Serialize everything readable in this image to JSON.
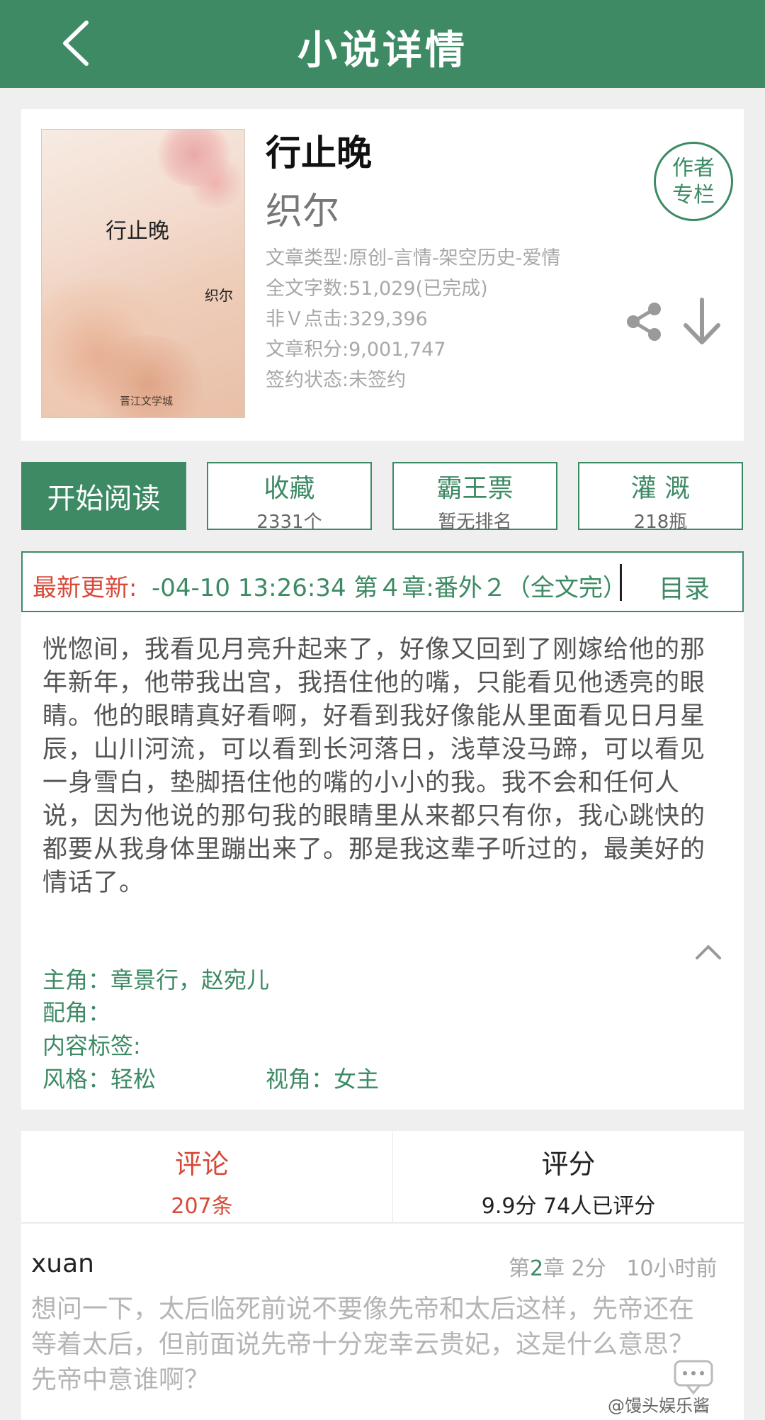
{
  "header": {
    "title": "小说详情"
  },
  "book": {
    "cover": {
      "title": "行止晚",
      "author": "织尔",
      "publisher": "晋江文学城"
    },
    "title": "行止晚",
    "author": "织尔",
    "meta": [
      "文章类型:原创-言情-架空历史-爱情",
      "全文字数:51,029(已完成)",
      "非Ｖ点击:329,396",
      "文章积分:9,001,747",
      "签约状态:未签约"
    ],
    "author_badge": {
      "line1": "作者",
      "line2": "专栏"
    }
  },
  "actions": {
    "read": "开始阅读",
    "favorite": {
      "label": "收藏",
      "value": "2331个"
    },
    "ticket": {
      "label": "霸王票",
      "value": "暂无排名"
    },
    "water": {
      "label": "灌 溉",
      "value": "218瓶"
    }
  },
  "update": {
    "label": "最新更新:",
    "text": "-04-10 13:26:34   第４章:番外２（全文完）",
    "toc": "目录"
  },
  "intro": {
    "text": "恍惚间，我看见月亮升起来了，好像又回到了刚嫁给他的那年新年，他带我出宫，我捂住他的嘴，只能看见他透亮的眼睛。他的眼睛真好看啊，好看到我好像能从里面看见日月星辰，山川河流，可以看到长河落日，浅草没马蹄，可以看见一身雪白，垫脚捂住他的嘴的小小的我。我不会和任何人说，因为他说的那句我的眼睛里从来都只有你，我心跳快的都要从我身体里蹦出来了。那是我这辈子听过的，最美好的情话了。",
    "protagonists": "主角：章景行，赵宛儿",
    "supporting": "配角：",
    "tags": "内容标签:",
    "style": "风格：轻松",
    "perspective": "视角：女主"
  },
  "tabs": {
    "comments": {
      "label": "评论",
      "count": "207条"
    },
    "rating": {
      "label": "评分",
      "value": "9.9分 74人已评分"
    }
  },
  "comment": {
    "user": "xuan",
    "chapter_prefix": "第",
    "chapter_num": "2",
    "chapter_suffix": "章",
    "score": "2分",
    "time": "10小时前",
    "body": "想问一下，太后临死前说不要像先帝和太后这样，先帝还在等着太后，但前面说先帝十分宠幸云贵妃，这是什么意思？先帝中意谁啊？"
  },
  "watermark": "@馒头娱乐酱",
  "colors": {
    "primary": "#3d8a64",
    "accent_red": "#d64a3a",
    "muted": "#a8a8a8"
  },
  "icons": [
    "back-arrow-icon",
    "share-icon",
    "download-icon",
    "collapse-chevron-icon",
    "chat-bubble-icon"
  ]
}
